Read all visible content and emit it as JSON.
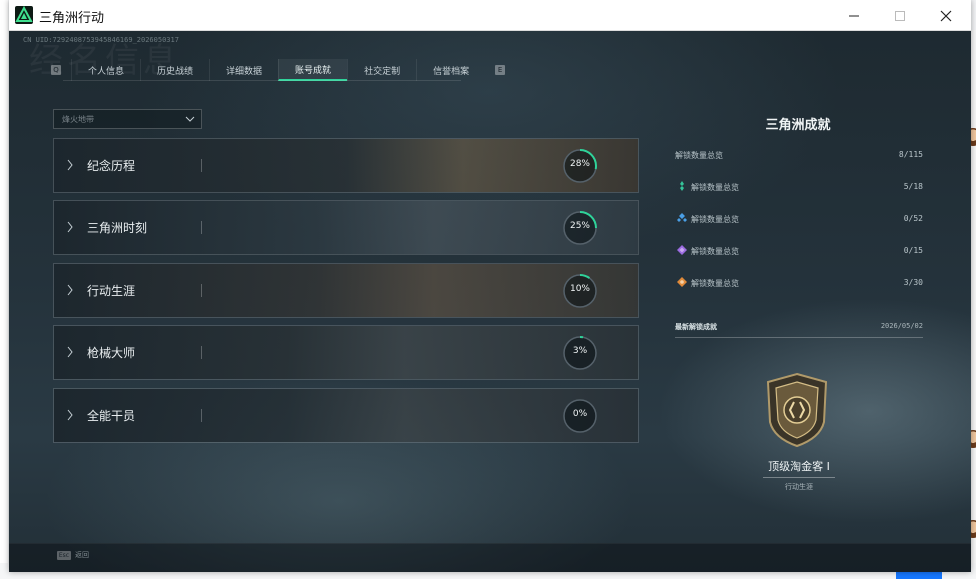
{
  "window": {
    "title": "三角洲行动"
  },
  "uid_text": "CN UID:7292408753945846169_2026050317",
  "ghost_title": "经名信息",
  "tabs": {
    "left_key": "Q",
    "right_key": "E",
    "items": [
      {
        "label": "个人信息"
      },
      {
        "label": "历史战绩"
      },
      {
        "label": "详细数据"
      },
      {
        "label": "账号成就",
        "active": true
      },
      {
        "label": "社交定制"
      },
      {
        "label": "信誉档案"
      }
    ]
  },
  "filter": {
    "label": "烽火地带"
  },
  "categories": [
    {
      "label": "纪念历程",
      "progress": 28,
      "progress_text": "28%"
    },
    {
      "label": "三角洲时刻",
      "progress": 25,
      "progress_text": "25%"
    },
    {
      "label": "行动生涯",
      "progress": 10,
      "progress_text": "10%"
    },
    {
      "label": "枪械大师",
      "progress": 3,
      "progress_text": "3%"
    },
    {
      "label": "全能干员",
      "progress": 0,
      "progress_text": "0%"
    }
  ],
  "panel": {
    "title": "三角洲成就",
    "total": {
      "label": "解锁数量总览",
      "value": "8/115"
    },
    "tiers": [
      {
        "label": "解锁数量总览",
        "value": "5/18",
        "color": "#35c49a"
      },
      {
        "label": "解锁数量总览",
        "value": "0/52",
        "color": "#4a9fe6"
      },
      {
        "label": "解锁数量总览",
        "value": "0/15",
        "color": "#9b6ae0"
      },
      {
        "label": "解锁数量总览",
        "value": "3/30",
        "color": "#e08a3a"
      }
    ],
    "latest": {
      "label": "最新解锁成就",
      "date": "2026/05/02"
    },
    "badge": {
      "name": "顶级淘金客 I",
      "category": "行动生涯"
    }
  },
  "footer": {
    "esc_key": "Esc",
    "esc_label": "返回"
  },
  "colors": {
    "accent": "#2fd39a",
    "ring_track": "#55616a"
  }
}
